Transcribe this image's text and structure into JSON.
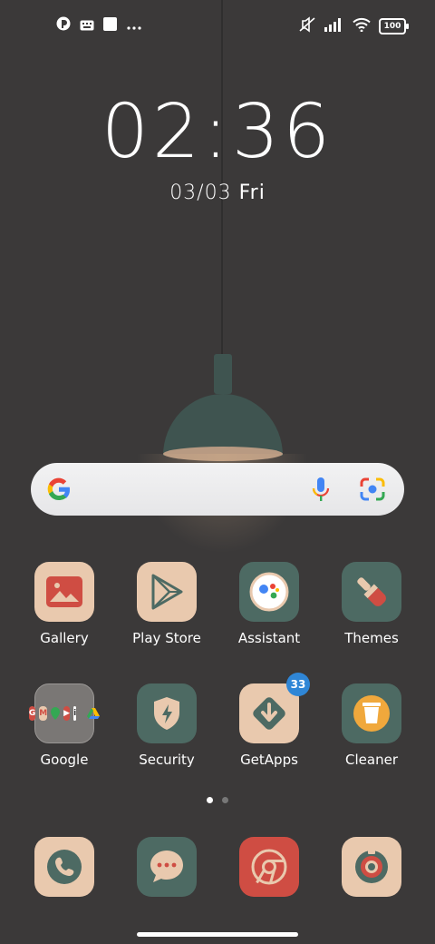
{
  "status_bar": {
    "battery_level": "100",
    "left_icons": [
      "app-notification-icon",
      "keyboard-icon",
      "square-notification-icon",
      "more-dots-icon"
    ],
    "right_icons": [
      "mute-icon",
      "signal-icon",
      "wifi-icon",
      "battery-icon"
    ]
  },
  "lock": {
    "time": "02:36",
    "date": "03/03",
    "day": "Fri"
  },
  "search": {
    "logo": "google-g-icon",
    "voice": "mic-icon",
    "lens": "lens-camera-icon"
  },
  "apps": [
    {
      "label": "Gallery",
      "icon": "gallery-icon"
    },
    {
      "label": "Play Store",
      "icon": "play-store-icon"
    },
    {
      "label": "Assistant",
      "icon": "assistant-icon"
    },
    {
      "label": "Themes",
      "icon": "themes-brush-icon"
    },
    {
      "label": "Google",
      "icon": "folder-icon"
    },
    {
      "label": "Security",
      "icon": "security-shield-icon"
    },
    {
      "label": "GetApps",
      "icon": "getapps-icon",
      "badge": "33"
    },
    {
      "label": "Cleaner",
      "icon": "cleaner-bin-icon"
    }
  ],
  "dock": [
    {
      "icon": "phone-icon"
    },
    {
      "icon": "messages-icon"
    },
    {
      "icon": "chrome-icon"
    },
    {
      "icon": "camera-icon"
    }
  ],
  "pager": {
    "pages": 2,
    "current": 1
  },
  "colors": {
    "background": "#3b3939",
    "tile_beige": "#e9c9ae",
    "tile_teal": "#4d6a63",
    "tile_red": "#cf4d43",
    "badge": "#2f86d6"
  }
}
